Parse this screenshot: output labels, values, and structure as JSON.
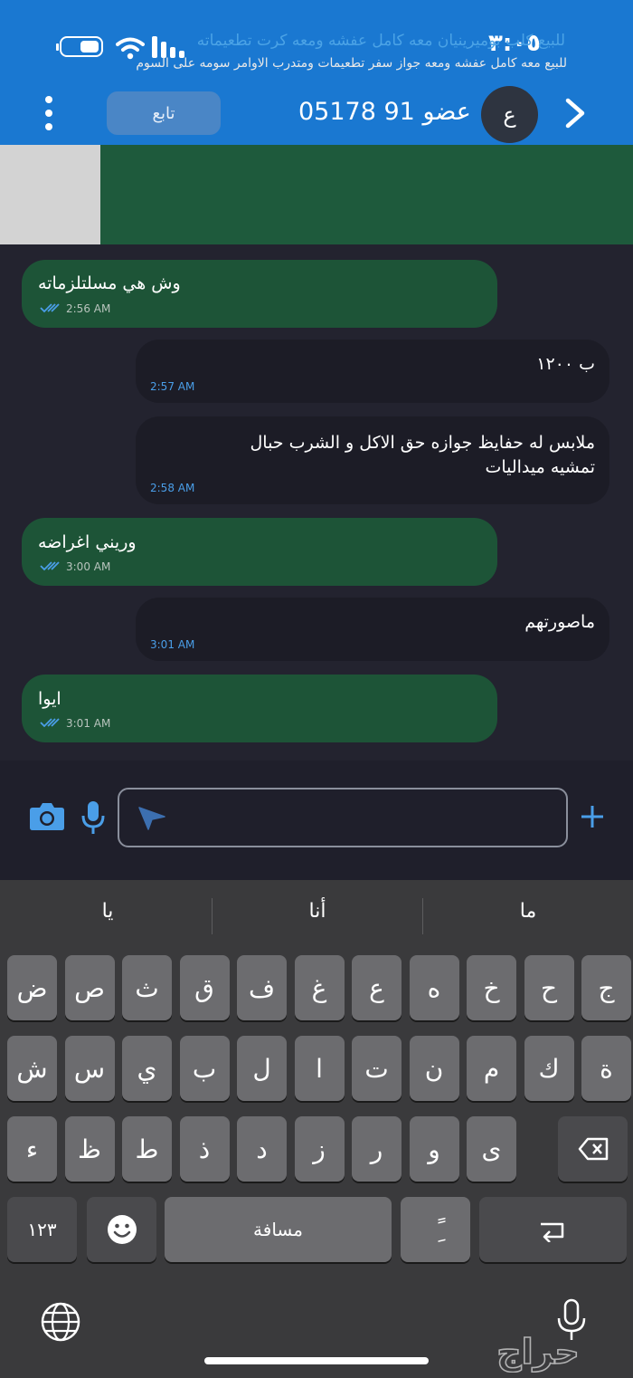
{
  "status_bar": {
    "time": "٣:٠٥"
  },
  "header": {
    "title": "عضو 91 05178",
    "avatar_letter": "ع",
    "follow_label": "تابع"
  },
  "ad": {
    "title": "للبيع كلب بوميرينيان معه كامل عفشه ومعه كرت تطعيماته",
    "description": "للبيع معه كامل عفشه ومعه جواز سفر تطعيمات ومتدرب الاوامر سومه على السوم"
  },
  "messages": [
    {
      "direction": "out",
      "lines": [
        "وش هي مسلتلزماته"
      ],
      "time": "2:56 AM",
      "read": true
    },
    {
      "direction": "in",
      "lines": [
        "ب ١٢٠٠"
      ],
      "time": "2:57 AM"
    },
    {
      "direction": "in",
      "lines": [
        "ملابس له حفايظ جوازه حق الاكل و الشرب حبال",
        "تمشيه ميداليات"
      ],
      "time": "2:58 AM"
    },
    {
      "direction": "out",
      "lines": [
        "وريني اغراضه"
      ],
      "time": "3:00 AM",
      "read": true
    },
    {
      "direction": "in",
      "lines": [
        "ماصورتهم"
      ],
      "time": "3:01 AM"
    },
    {
      "direction": "out",
      "lines": [
        "ايوا"
      ],
      "time": "3:01 AM",
      "read": true
    }
  ],
  "composer": {
    "value": "",
    "placeholder": ""
  },
  "keyboard": {
    "suggestions": [
      "يا",
      "أنا",
      "ما"
    ],
    "row1": [
      "ض",
      "ص",
      "ث",
      "ق",
      "ف",
      "غ",
      "ع",
      "ه",
      "خ",
      "ح",
      "ج"
    ],
    "row2": [
      "ش",
      "س",
      "ي",
      "ب",
      "ل",
      "ا",
      "ت",
      "ن",
      "م",
      "ك",
      "ة"
    ],
    "row3": [
      "ء",
      "ظ",
      "ط",
      "ذ",
      "د",
      "ز",
      "ر",
      "و",
      "ى"
    ],
    "numbers_label": "١٢٣",
    "space_label": "مسافة",
    "diacritic_label": "ًِ"
  },
  "watermark": "حراج",
  "colors": {
    "header": "#1a78d1",
    "outgoing_bubble": "#1d5437",
    "incoming_bubble": "#1c1c26",
    "ad_background": "#1e5a3c",
    "accent_blue": "#4a9ee8"
  }
}
